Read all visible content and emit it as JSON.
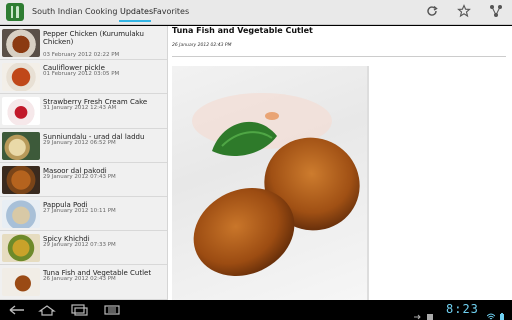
{
  "app": {
    "title": "South Indian Cooking"
  },
  "tabs": [
    {
      "label": "Updates"
    },
    {
      "label": "Favorites"
    }
  ],
  "clock": "8:23",
  "list": {
    "items": [
      {
        "title": "Pepper Chicken (Kurumulaku Chicken)",
        "date": "03 February 2012 02:22 PM"
      },
      {
        "title": "Cauliflower pickle",
        "date": "01 February 2012 03:05 PM"
      },
      {
        "title": "Strawberry Fresh Cream Cake",
        "date": "31 January 2012 12:43 AM"
      },
      {
        "title": "Sunniundalu - urad dal laddu",
        "date": "29 January 2012 06:52 PM"
      },
      {
        "title": "Masoor dal pakodi",
        "date": "29 January 2012 07:43 PM"
      },
      {
        "title": "Pappula Podi",
        "date": "27 January 2012 10:11 PM"
      },
      {
        "title": "Spicy Khichdi",
        "date": "29 January 2012 07:33 PM"
      },
      {
        "title": "Tuna Fish and Vegetable Cutlet",
        "date": "26 January 2012 02:43 PM"
      }
    ]
  },
  "detail": {
    "title": "Tuna Fish and Vegetable Cutlet",
    "date": "26 January 2012 02:43 PM"
  },
  "colors": {
    "accent": "#33b5e5",
    "clock": "#6fd0f0"
  }
}
